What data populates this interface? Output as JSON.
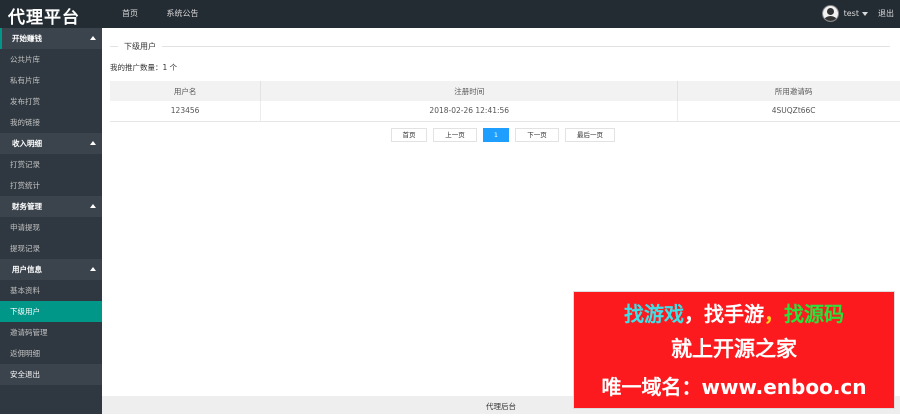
{
  "header": {
    "logo": "代理平台",
    "nav": [
      "首页",
      "系统公告"
    ],
    "username": "test",
    "logout": "退出"
  },
  "sidebar": {
    "groups": [
      {
        "title": "开始赚钱",
        "items": [
          "公共片库",
          "私有片库",
          "发布打赏",
          "我的链接"
        ]
      },
      {
        "title": "收入明细",
        "items": [
          "打赏记录",
          "打赏统计"
        ]
      },
      {
        "title": "财务管理",
        "items": [
          "申请提现",
          "提现记录"
        ]
      },
      {
        "title": "用户信息",
        "items": [
          "基本资料",
          "下级用户",
          "邀请码管理",
          "返佣明细"
        ]
      }
    ],
    "solo_item": "安全退出",
    "active_item": "下级用户"
  },
  "main": {
    "section_title": "下级用户",
    "promo_count_label": "我的推广数量：",
    "promo_count_value": "1 个",
    "table": {
      "headers": [
        "用户名",
        "注册时间",
        "所用邀请码"
      ],
      "rows": [
        [
          "123456",
          "2018-02-26 12:41:56",
          "4SUQZt66C"
        ]
      ]
    },
    "pager": {
      "first": "首页",
      "prev": "上一页",
      "current": "1",
      "next": "下一页",
      "last": "最后一页"
    }
  },
  "footer": {
    "text": "代理后台"
  },
  "ad": {
    "line1": [
      "找游戏",
      "，找手游",
      "，",
      "找源码"
    ],
    "line2": "就上开源之家",
    "line3": "唯一域名：www.enboo.cn"
  }
}
